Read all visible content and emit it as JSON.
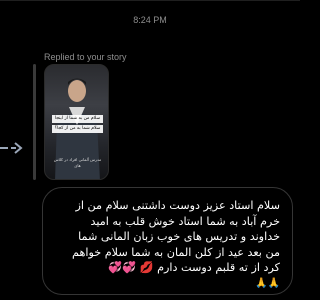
{
  "chat": {
    "timestamp": "8:24 PM",
    "reply_label": "Replied to your story"
  },
  "story": {
    "overlay_lines": [
      "سلام من به شما از اینجا",
      "سلام شما به من از کجا؟"
    ],
    "caption": "مدرس آلمانی افراد در کلاس های"
  },
  "message": {
    "lines": [
      "سلام استاد عزیز دوست داشتنی سلام من از",
      "خرم آباد به شما استاد خوش قلب  به امید",
      "خداوند و تدریس های خوب زبان المانی شما",
      "من بعد عید از کلن المان به شما سلام خواهم",
      "کرد از ته قلبم دوست دارم 💋 💞💞"
    ],
    "emoji_line": "🙏🙏"
  },
  "colors": {
    "background": "#000000",
    "secondary_text": "#8e8e8e",
    "bubble_border": "#353535"
  }
}
